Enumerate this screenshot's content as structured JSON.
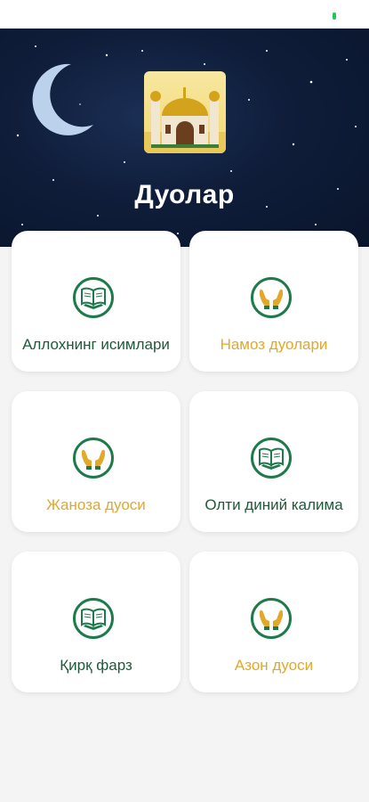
{
  "app": {
    "title": "Дуолар"
  },
  "colors": {
    "green": "#1e7a4a",
    "gold": "#e2a82a",
    "label_green": "#1d5a3a"
  },
  "cards": [
    {
      "label": "Аллохнинг исимлари",
      "icon": "quran-book-icon",
      "label_color": "green"
    },
    {
      "label": "Намоз дуолари",
      "icon": "praying-hands-icon",
      "label_color": "gold"
    },
    {
      "label": "Жаноза дуоси",
      "icon": "praying-hands-icon",
      "label_color": "gold"
    },
    {
      "label": "Олти диний калима",
      "icon": "quran-book-icon",
      "label_color": "green"
    },
    {
      "label": "Қирқ фарз",
      "icon": "quran-book-icon",
      "label_color": "green"
    },
    {
      "label": "Азон дуоси",
      "icon": "praying-hands-icon",
      "label_color": "gold"
    }
  ]
}
